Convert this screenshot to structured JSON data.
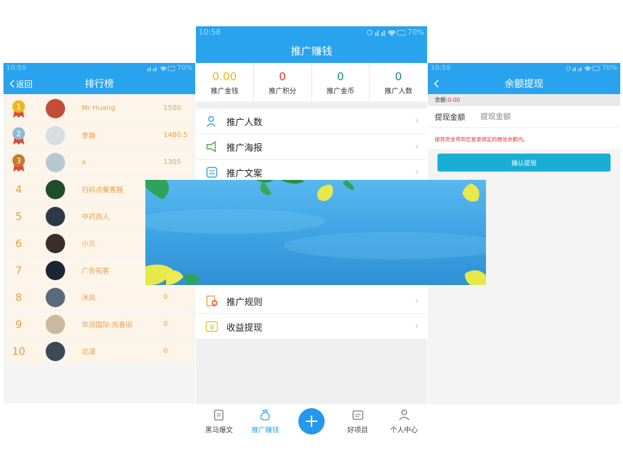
{
  "left": {
    "status_time": "10:59",
    "status_battery": "70%",
    "back_label": "返回",
    "title": "排行榜",
    "rows": [
      {
        "rank": "1",
        "name": "Mr Huang",
        "score": "1500",
        "medal": true,
        "medal_color": "#f2b51f"
      },
      {
        "rank": "2",
        "name": "李静",
        "score": "1480.5",
        "medal": true,
        "medal_color": "#8fbad0"
      },
      {
        "rank": "3",
        "name": "a",
        "score": "1305",
        "medal": true,
        "medal_color": "#c77a2a"
      },
      {
        "rank": "4",
        "name": "扫码点餐客服",
        "score": "",
        "medal": false
      },
      {
        "rank": "5",
        "name": "中药商人",
        "score": "",
        "medal": false
      },
      {
        "rank": "6",
        "name": "小贝",
        "score": "",
        "medal": false
      },
      {
        "rank": "7",
        "name": "广告拓客",
        "score": "",
        "medal": false
      },
      {
        "rank": "8",
        "name": "沐风",
        "score": "0",
        "medal": false
      },
      {
        "rank": "9",
        "name": "华润国际:尚春丽",
        "score": "0",
        "medal": false
      },
      {
        "rank": "10",
        "name": "北漠",
        "score": "0",
        "medal": false
      }
    ]
  },
  "mid": {
    "status_time": "10:58",
    "status_battery": "70%",
    "title": "推广赚钱",
    "stats": [
      {
        "value": "0.00",
        "label": "推广金钱",
        "color": "#f2b51f"
      },
      {
        "value": "0",
        "label": "推广积分",
        "color": "#e23535"
      },
      {
        "value": "0",
        "label": "推广金币",
        "color": "#1a8a8a"
      },
      {
        "value": "0",
        "label": "推广人数",
        "color": "#1a8a8a"
      }
    ],
    "menu": [
      {
        "label": "推广人数",
        "icon": "person-icon"
      },
      {
        "label": "推广海报",
        "icon": "megaphone-icon"
      },
      {
        "label": "推广文案",
        "icon": "document-icon"
      },
      {
        "label": "推广规则",
        "icon": "rules-icon"
      },
      {
        "label": "收益提现",
        "icon": "withdraw-icon"
      }
    ],
    "nav": [
      {
        "label": "黑马爆文",
        "icon": "clipboard-icon"
      },
      {
        "label": "推广赚钱",
        "icon": "moneybag-icon"
      },
      {
        "label": "+",
        "icon": "plus-icon"
      },
      {
        "label": "好项目",
        "icon": "folder-icon"
      },
      {
        "label": "个人中心",
        "icon": "user-icon"
      }
    ]
  },
  "right": {
    "status_time": "10:59",
    "status_battery": "70%",
    "title": "余额提现",
    "balance_label": "余额:",
    "balance_value": "0.00",
    "withdraw_label": "提现金额",
    "withdraw_placeholder": "提现金额",
    "notice": "提现资金将到您登录绑定的微信余额内。",
    "confirm_label": "确认提现"
  },
  "colors": {
    "brand_blue": "#2aa3ee",
    "gold": "#e8a24a",
    "red": "#e23535",
    "teal_button": "#18aed6"
  }
}
